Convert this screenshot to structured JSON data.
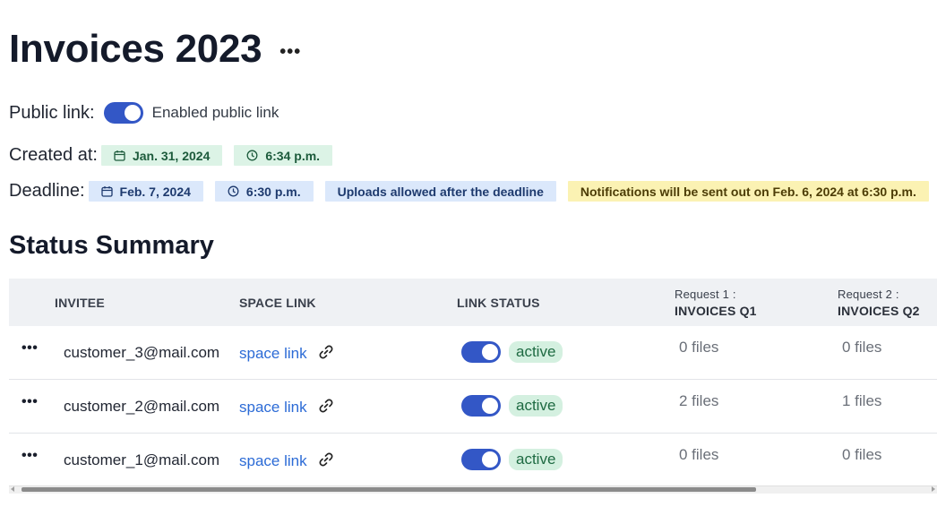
{
  "page": {
    "title": "Invoices 2023",
    "more_label": "•••"
  },
  "public_link": {
    "label": "Public link:",
    "toggle_state": "on",
    "toggle_label": "Enabled public link"
  },
  "created": {
    "label": "Created at:",
    "date": "Jan. 31, 2024",
    "time": "6:34 p.m."
  },
  "deadline": {
    "label": "Deadline:",
    "date": "Feb. 7, 2024",
    "time": "6:30 p.m.",
    "uploads_note": "Uploads allowed after the deadline",
    "notifications_note": "Notifications will be sent out on Feb. 6, 2024 at 6:30 p.m."
  },
  "summary": {
    "title": "Status Summary",
    "columns": {
      "invitee": "INVITEE",
      "space_link": "SPACE LINK",
      "link_status": "LINK STATUS",
      "request1_prefix": "Request 1 :",
      "request1_name": "INVOICES Q1",
      "request2_prefix": "Request 2 :",
      "request2_name": "INVOICES Q2"
    },
    "rows": [
      {
        "more": "•••",
        "invitee": "customer_3@mail.com",
        "link": "space link",
        "status": "active",
        "toggle_state": "on",
        "req1": "0 files",
        "req2": "0 files"
      },
      {
        "more": "•••",
        "invitee": "customer_2@mail.com",
        "link": "space link",
        "status": "active",
        "toggle_state": "on",
        "req1": "2 files",
        "req2": "1 files"
      },
      {
        "more": "•••",
        "invitee": "customer_1@mail.com",
        "link": "space link",
        "status": "active",
        "toggle_state": "on",
        "req1": "0 files",
        "req2": "0 files"
      }
    ]
  },
  "icons": {
    "calendar": "calendar-icon",
    "clock": "clock-icon",
    "link": "link-icon",
    "more": "more-icon"
  },
  "colors": {
    "accent": "#3357c6",
    "link": "#2c6bd6",
    "chip_green": "#dcf3e6",
    "chip_blue": "#dbe8fb",
    "chip_yellow": "#fbf2b3",
    "badge_active": "#d4f0e0"
  }
}
